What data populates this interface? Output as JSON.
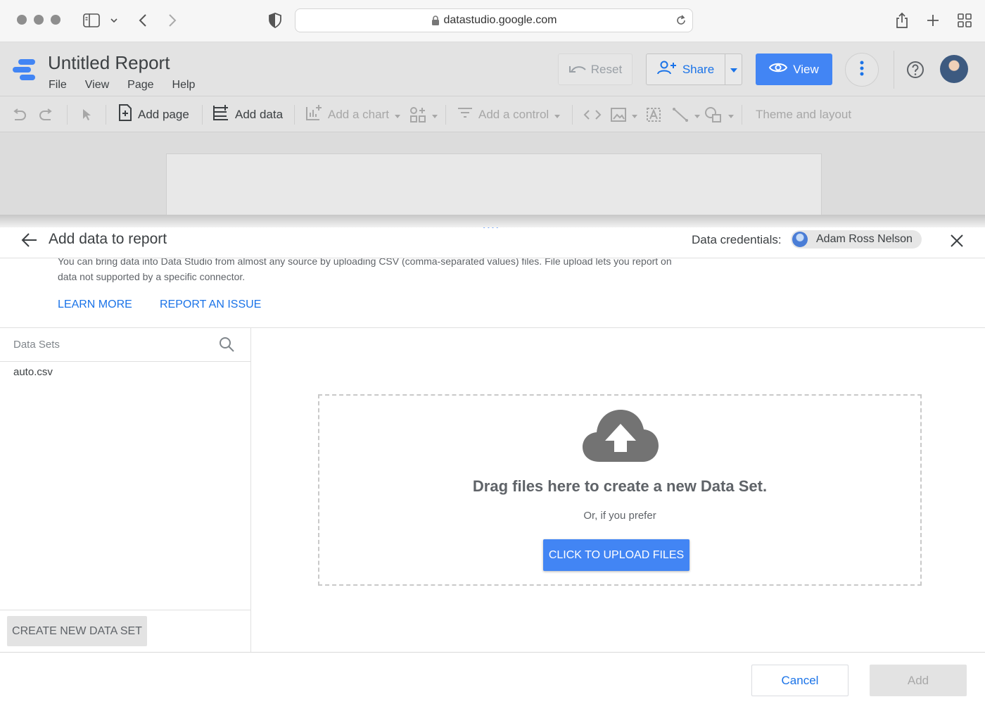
{
  "browser": {
    "url": "datastudio.google.com"
  },
  "header": {
    "title": "Untitled Report",
    "menu": [
      "File",
      "View",
      "Page",
      "Help"
    ],
    "reset_label": "Reset",
    "share_label": "Share",
    "view_label": "View"
  },
  "toolbar": {
    "add_page": "Add page",
    "add_data": "Add data",
    "add_chart": "Add a chart",
    "add_control": "Add a control",
    "theme_layout": "Theme and layout"
  },
  "panel": {
    "title": "Add data to report",
    "credentials_label": "Data credentials:",
    "credentials_user": "Adam Ross Nelson",
    "description": "You can bring data into Data Studio from almost any source by uploading CSV (comma-separated values) files. File upload lets you report on data not supported by a specific connector.",
    "learn_more": "LEARN MORE",
    "report_issue": "REPORT AN ISSUE",
    "data_sets_label": "Data Sets",
    "data_sets": [
      "auto.csv"
    ],
    "create_new": "CREATE NEW DATA SET",
    "drop_title": "Drag files here to create a new Data Set.",
    "drop_sub": "Or, if you prefer",
    "upload_button": "CLICK TO UPLOAD FILES"
  },
  "footer": {
    "cancel": "Cancel",
    "add": "Add"
  },
  "colors": {
    "accent": "#4285f4",
    "link": "#1a73e8"
  }
}
